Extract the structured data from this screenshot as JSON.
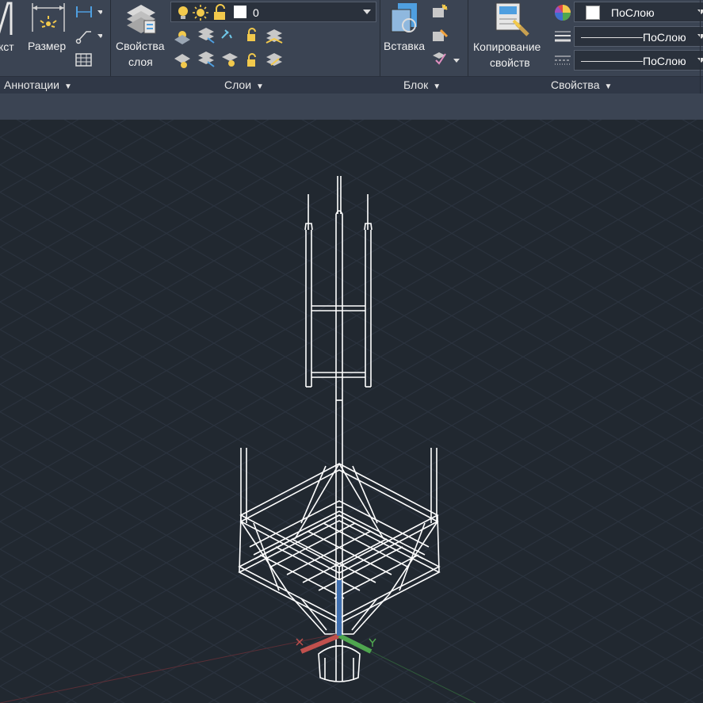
{
  "ribbon": {
    "annotation": {
      "text_label_partial": "кст",
      "size_label": "Размер",
      "panel_title": "Аннотации"
    },
    "layers": {
      "layer_properties_label_1": "Свойства",
      "layer_properties_label_2": "слоя",
      "current_layer": "0",
      "panel_title": "Слои"
    },
    "block": {
      "insert_label": "Вставка",
      "panel_title": "Блок"
    },
    "properties": {
      "match_label_1": "Копирование",
      "match_label_2": "свойств",
      "color_value": "ПоСлою",
      "lineweight_value": "ПоСлою",
      "linetype_value": "ПоСлою",
      "panel_title": "Свойства"
    }
  },
  "colors": {
    "ribbon_bg": "#3b4453",
    "viewport_bg": "#212830",
    "grid": "#2c3440",
    "model": "#ffffff",
    "ucs_x": "#c0504d",
    "ucs_y": "#4fa64f",
    "ucs_z": "#3f6fb0"
  }
}
